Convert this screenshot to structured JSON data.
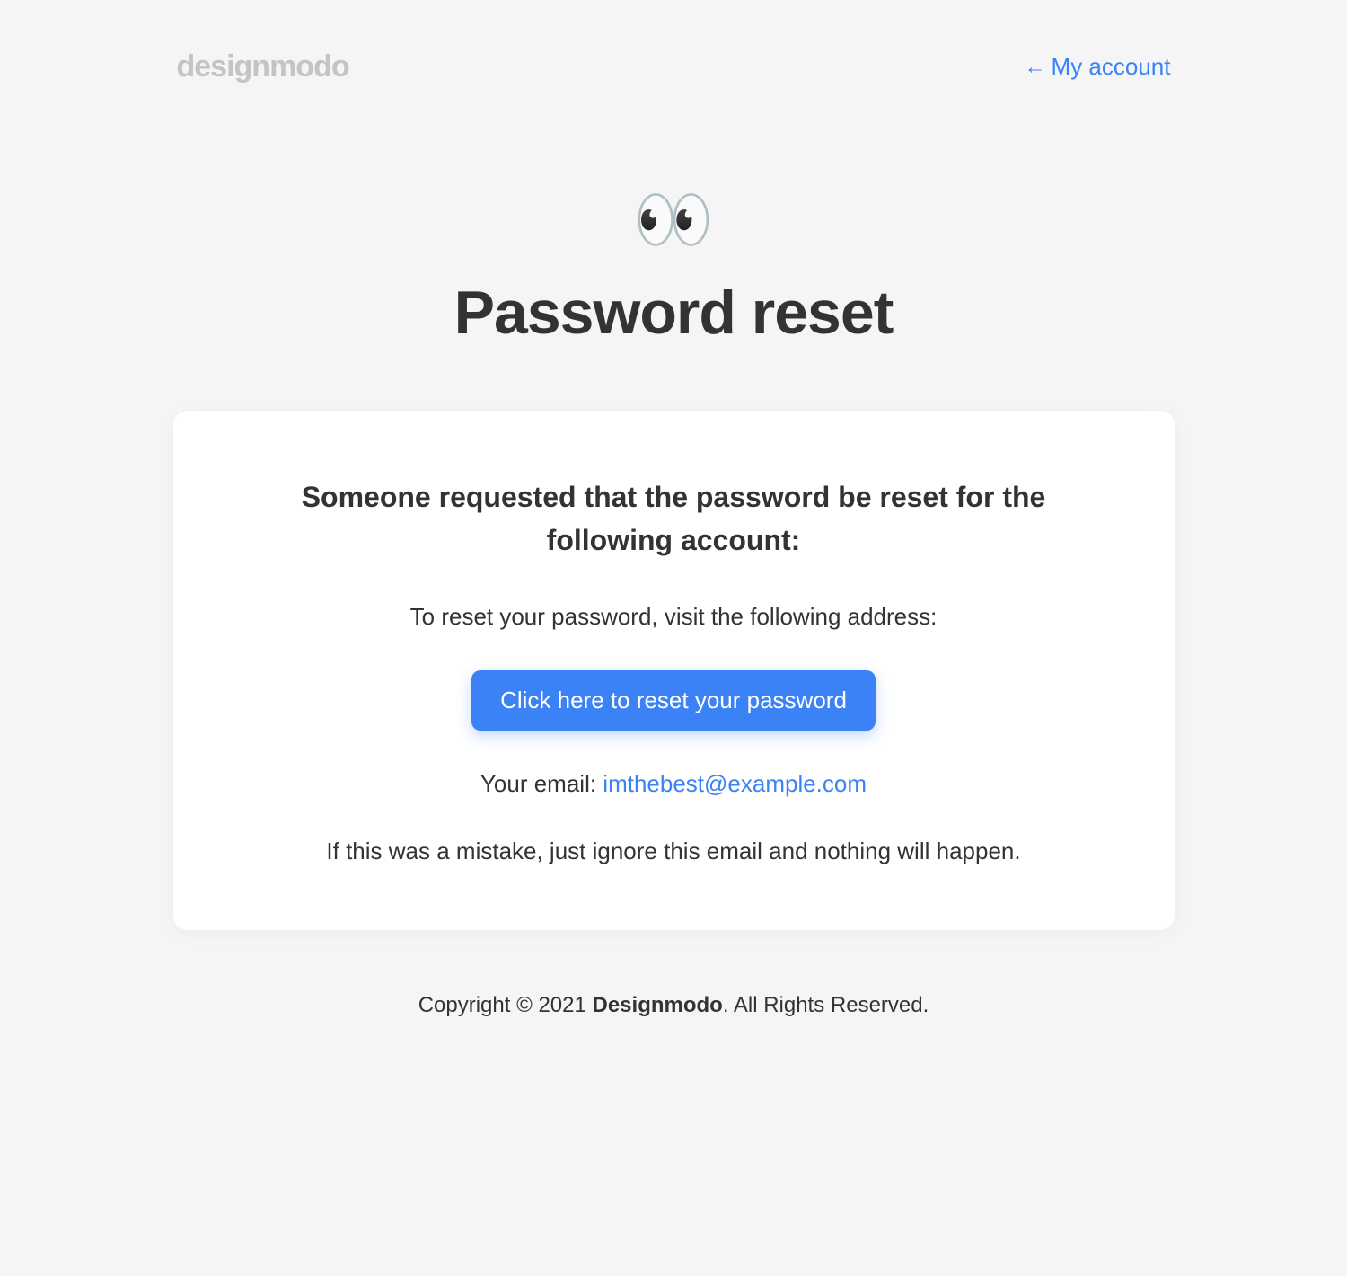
{
  "header": {
    "logo": "designmodo",
    "account_link": "My account",
    "arrow": "←"
  },
  "hero": {
    "emoji": "👀",
    "title": "Password reset"
  },
  "card": {
    "heading": "Someone requested that the password be reset for the following account:",
    "instruction": "To reset your password, visit the following address:",
    "button": "Click here to reset your password",
    "email_label": "Your email: ",
    "email_value": "imthebest@example.com",
    "mistake": "If this was a mistake, just ignore this email and nothing will happen."
  },
  "footer": {
    "prefix": "Copyright © 2021 ",
    "brand": "Designmodo",
    "suffix": ". All Rights Reserved."
  }
}
